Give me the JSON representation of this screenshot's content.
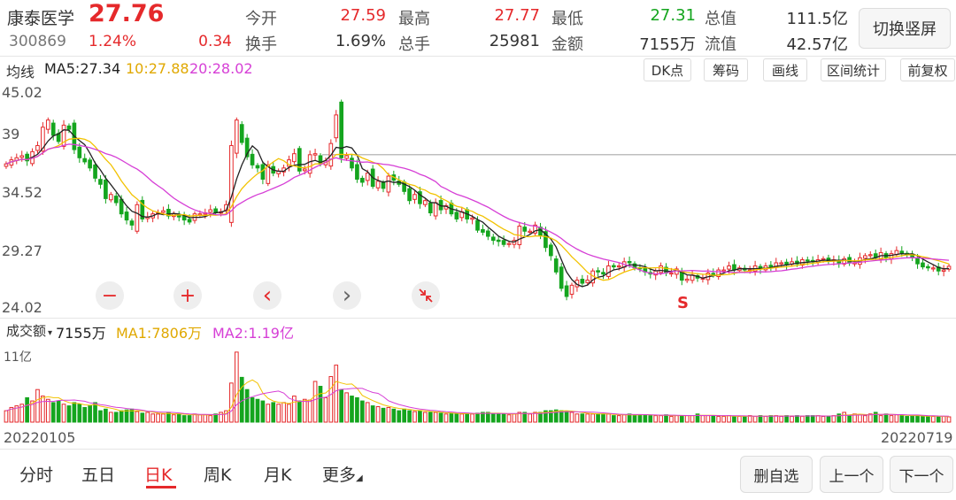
{
  "stock": {
    "name": "康泰医学",
    "price": "27.76",
    "code": "300869",
    "change_pct": "1.24%",
    "change_amt": "0.34",
    "open_label": "今开",
    "open": "27.59",
    "high_label": "最高",
    "high": "27.77",
    "low_label": "最低",
    "low": "27.31",
    "mktcap_label": "总值",
    "mktcap": "111.5亿",
    "turnover_label": "换手",
    "turnover": "1.69%",
    "volume_label": "总手",
    "volume": "25981",
    "amount_label": "金额",
    "amount": "7155万",
    "float_label": "流值",
    "float": "42.57亿",
    "switch_label": "切换竖屏"
  },
  "indicators": {
    "ma_label": "均线",
    "ma5": "MA5:27.34",
    "ma10": "10:27.88",
    "ma20": "20:28.02",
    "tools": [
      "DK点",
      "筹码",
      "画线",
      "区间统计",
      "前复权"
    ]
  },
  "colors": {
    "up": "#e5292b",
    "down": "#14a51e",
    "ma5": "#222222",
    "ma10": "#f2c200",
    "ma20": "#d63fd6",
    "refline": "#aaaaaa"
  },
  "controls": {
    "zoom_out": "−",
    "zoom_in": "+",
    "prev": "‹",
    "next": "›",
    "reset_icon": "collapse-arrows-icon"
  },
  "volume_panel": {
    "label": "成交额",
    "value": "7155万",
    "ma1": "MA1:7806万",
    "ma2": "MA2:1.19亿",
    "scale": "11亿"
  },
  "x_labels": {
    "start": "20220105",
    "end": "20220719"
  },
  "signal": {
    "letter": "S"
  },
  "chart_data": {
    "type": "candlestick",
    "y_ticks": [
      "45.02",
      "39",
      "34.52",
      "29.27",
      "24.02"
    ],
    "ylim": [
      24.02,
      45.02
    ],
    "reference_line": 38.7,
    "ma5_last": 27.34,
    "ma10_last": 27.88,
    "ma20_last": 28.02,
    "close": [
      37.8,
      38.2,
      38.4,
      38.6,
      38.1,
      39.0,
      39.6,
      41.4,
      42.1,
      40.6,
      40.0,
      41.6,
      41.2,
      39.2,
      38.4,
      38.0,
      37.4,
      36.4,
      35.8,
      34.4,
      34.8,
      34.0,
      32.9,
      32.3,
      31.8,
      33.8,
      32.4,
      32.6,
      32.9,
      33.0,
      33.2,
      32.7,
      32.9,
      32.6,
      32.3,
      32.1,
      32.9,
      32.9,
      33.0,
      33.3,
      33.0,
      33.1,
      33.8,
      39.6,
      42.1,
      39.9,
      38.5,
      37.7,
      37.4,
      36.3,
      37.7,
      36.9,
      37.1,
      37.4,
      38.2,
      38.8,
      37.1,
      37.3,
      38.7,
      38.8,
      37.8,
      38.1,
      39.8,
      42.6,
      38.4,
      38.6,
      37.4,
      36.3,
      36.0,
      36.9,
      35.6,
      36.1,
      35.4,
      36.6,
      36.2,
      35.8,
      35.1,
      34.2,
      34.8,
      33.9,
      34.2,
      33.0,
      34.0,
      33.3,
      33.7,
      32.9,
      32.4,
      33.1,
      32.4,
      32.5,
      31.3,
      31.1,
      30.7,
      30.3,
      30.2,
      29.9,
      30.0,
      30.3,
      31.7,
      31.2,
      31.2,
      31.8,
      30.8,
      29.6,
      28.8,
      27.2,
      25.6,
      24.8,
      25.9,
      26.4,
      26.1,
      26.4,
      27.3,
      27.2,
      27.0,
      27.8,
      27.7,
      27.8,
      28.2,
      28.1,
      27.6,
      27.5,
      27.2,
      27.0,
      27.3,
      27.8,
      27.1,
      27.1,
      27.5,
      26.4,
      26.5,
      26.9,
      26.6,
      26.6,
      27.1,
      26.9,
      27.4,
      27.4,
      27.8,
      27.4,
      27.6,
      27.4,
      27.4,
      27.8,
      27.5,
      27.8,
      27.6,
      28.1,
      28.1,
      27.9,
      28.2,
      28.0,
      28.4,
      28.3,
      28.2,
      28.4,
      28.5,
      28.3,
      28.4,
      28.1,
      28.5,
      28.1,
      28.1,
      28.6,
      28.8,
      28.9,
      28.6,
      29.1,
      28.6,
      29.0,
      29.3,
      29.0,
      28.9,
      28.7,
      28.0,
      27.7,
      27.6,
      27.6,
      27.3,
      27.4,
      27.76
    ],
    "volume_relative": [
      0.14,
      0.18,
      0.2,
      0.22,
      0.3,
      0.26,
      0.4,
      0.32,
      0.28,
      0.24,
      0.26,
      0.22,
      0.2,
      0.24,
      0.22,
      0.18,
      0.2,
      0.24,
      0.14,
      0.16,
      0.12,
      0.12,
      0.14,
      0.15,
      0.16,
      0.13,
      0.11,
      0.12,
      0.1,
      0.1,
      0.1,
      0.12,
      0.09,
      0.1,
      0.08,
      0.08,
      0.1,
      0.09,
      0.09,
      0.08,
      0.1,
      0.12,
      0.14,
      0.48,
      0.86,
      0.55,
      0.4,
      0.3,
      0.28,
      0.26,
      0.22,
      0.24,
      0.22,
      0.24,
      0.22,
      0.32,
      0.26,
      0.28,
      0.27,
      0.5,
      0.44,
      0.3,
      0.56,
      0.7,
      0.4,
      0.36,
      0.32,
      0.3,
      0.26,
      0.24,
      0.2,
      0.19,
      0.17,
      0.18,
      0.16,
      0.14,
      0.16,
      0.14,
      0.13,
      0.14,
      0.12,
      0.12,
      0.12,
      0.11,
      0.1,
      0.11,
      0.1,
      0.1,
      0.11,
      0.1,
      0.11,
      0.12,
      0.12,
      0.1,
      0.1,
      0.1,
      0.09,
      0.1,
      0.12,
      0.12,
      0.1,
      0.12,
      0.12,
      0.14,
      0.14,
      0.15,
      0.14,
      0.13,
      0.12,
      0.1,
      0.1,
      0.1,
      0.1,
      0.1,
      0.1,
      0.1,
      0.08,
      0.08,
      0.09,
      0.1,
      0.09,
      0.09,
      0.09,
      0.08,
      0.08,
      0.08,
      0.09,
      0.07,
      0.08,
      0.08,
      0.08,
      0.08,
      0.1,
      0.08,
      0.08,
      0.08,
      0.07,
      0.07,
      0.08,
      0.07,
      0.07,
      0.07,
      0.08,
      0.07,
      0.08,
      0.07,
      0.08,
      0.08,
      0.07,
      0.08,
      0.07,
      0.08,
      0.07,
      0.08,
      0.08,
      0.08,
      0.07,
      0.07,
      0.08,
      0.1,
      0.12,
      0.08,
      0.1,
      0.09,
      0.08,
      0.1,
      0.12,
      0.08,
      0.1,
      0.08,
      0.09,
      0.08,
      0.07,
      0.08,
      0.08,
      0.07,
      0.07,
      0.07,
      0.07,
      0.07,
      0.065
    ]
  },
  "tabs": [
    "分时",
    "五日",
    "日K",
    "周K",
    "月K",
    "更多"
  ],
  "active_tab": "日K",
  "actions": {
    "remove": "删自选",
    "prev": "上一个",
    "next": "下一个"
  }
}
